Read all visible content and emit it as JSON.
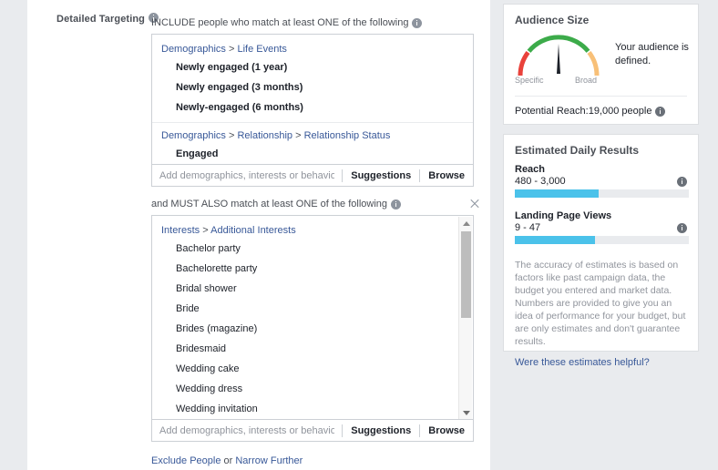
{
  "left": {
    "field_label": "Detailed Targeting",
    "include_header": "INCLUDE people who match at least ONE of the following",
    "must_also_header": "and MUST ALSO match at least ONE of the following",
    "include_box": {
      "groups": [
        {
          "crumb_parts": [
            "Demographics",
            "Life Events"
          ],
          "items": [
            "Newly engaged (1 year)",
            "Newly engaged (3 months)",
            "Newly-engaged (6 months)"
          ]
        },
        {
          "crumb_parts": [
            "Demographics",
            "Relationship",
            "Relationship Status"
          ],
          "items": [
            "Engaged"
          ]
        }
      ],
      "input_placeholder": "Add demographics, interests or behaviors",
      "suggestions_label": "Suggestions",
      "browse_label": "Browse"
    },
    "narrow_box": {
      "groups": [
        {
          "crumb_parts": [
            "Interests",
            "Additional Interests"
          ],
          "items": [
            "Bachelor party",
            "Bachelorette party",
            "Bridal shower",
            "Bride",
            "Brides (magazine)",
            "Bridesmaid",
            "Wedding cake",
            "Wedding dress",
            "Wedding invitation"
          ]
        }
      ],
      "input_placeholder": "Add demographics, interests or behaviors",
      "suggestions_label": "Suggestions",
      "browse_label": "Browse"
    },
    "bottom": {
      "exclude_label": "Exclude People",
      "or_label": "or",
      "narrow_label": "Narrow Further"
    }
  },
  "right": {
    "audience": {
      "title": "Audience Size",
      "gauge_low_label": "Specific",
      "gauge_high_label": "Broad",
      "message": "Your audience is defined.",
      "potential_reach": "Potential Reach:19,000 people",
      "needle_angle_deg": 0,
      "colors": {
        "low": "#e9423b",
        "mid": "#3cab4a",
        "high": "#f8c078",
        "needle": "#1d2129"
      }
    },
    "estimates": {
      "title": "Estimated Daily Results",
      "metrics": [
        {
          "name": "Reach",
          "value": "480 - 3,000",
          "fill_percent": 48
        },
        {
          "name": "Landing Page Views",
          "value": "9 - 47",
          "fill_percent": 46
        }
      ],
      "disclaimer": "The accuracy of estimates is based on factors like past campaign data, the budget you entered and market data. Numbers are provided to give you an idea of performance for your budget, but are only estimates and don't guarantee results.",
      "helpful_link": "Were these estimates helpful?",
      "bar_color": "#4bc2ea"
    }
  }
}
